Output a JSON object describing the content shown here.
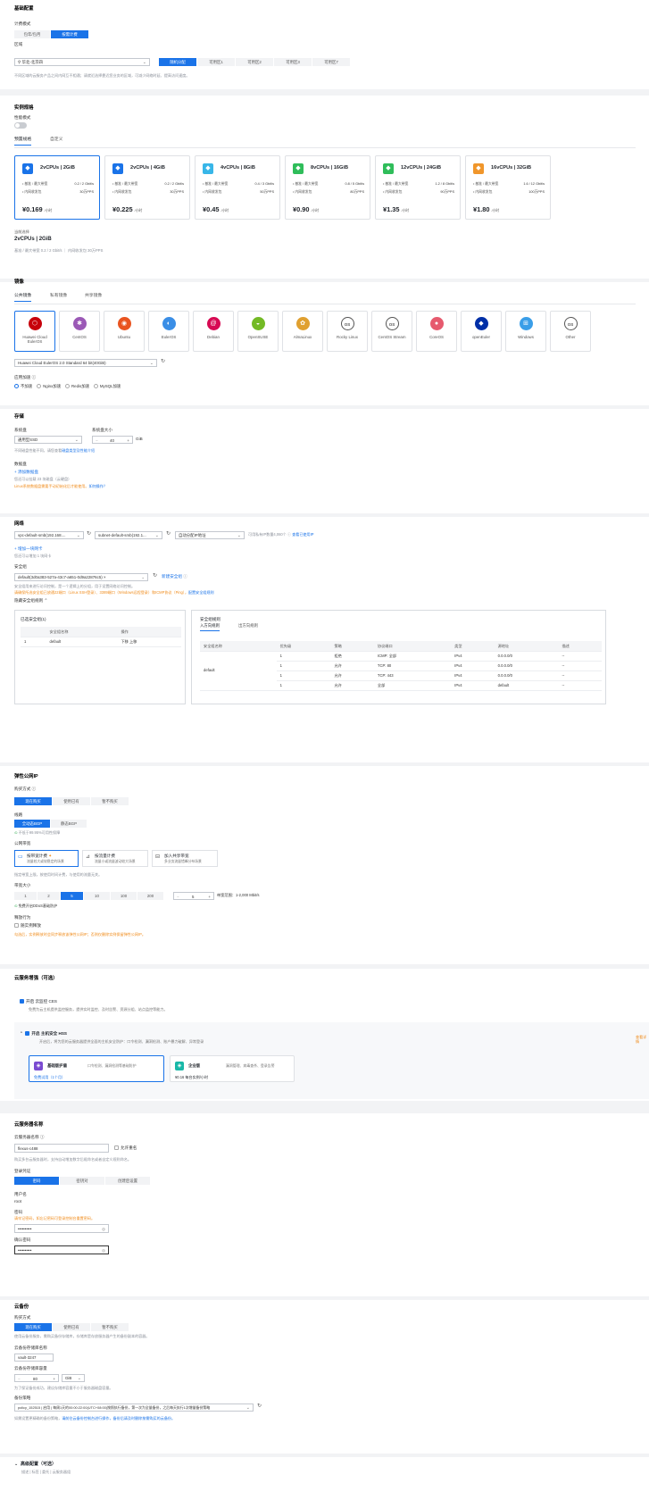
{
  "basic": {
    "title": "基础配置",
    "billing_label": "计费模式",
    "billing_options": [
      "包年/包月",
      "按需计费"
    ],
    "region_label": "区域",
    "region_value": "华北-北京四",
    "az_options": [
      "随机分配",
      "可用区1",
      "可用区2",
      "可用区3",
      "可用区7"
    ],
    "region_tip": "不同区域的云服务产品之间内网互不相通；请就近选择靠近您业务的区域，可减少网络时延、提高访问速度。"
  },
  "spec": {
    "title": "实例规格",
    "mode_label": "性能模式",
    "tabs": [
      "预置规格",
      "自定义"
    ],
    "bw_label": "基准 / 最大带宽",
    "pps_label": "内网收发包",
    "unit": "/小时",
    "cards": [
      {
        "name": "2vCPUs | 2GiB",
        "bw": "0.2 / 2 Gbit/s",
        "pps": "30万PPS",
        "price": "¥0.169",
        "icon": "◆",
        "color": "#1a73e8"
      },
      {
        "name": "2vCPUs | 4GiB",
        "bw": "0.2 / 2 Gbit/s",
        "pps": "30万PPS",
        "price": "¥0.225",
        "icon": "◆",
        "color": "#1a73e8"
      },
      {
        "name": "4vCPUs | 8GiB",
        "bw": "0.4 / 3 Gbit/s",
        "pps": "50万PPS",
        "price": "¥0.45",
        "icon": "◆",
        "color": "#38b6e8"
      },
      {
        "name": "8vCPUs | 16GiB",
        "bw": "0.8 / 5 Gbit/s",
        "pps": "80万PPS",
        "price": "¥0.90",
        "icon": "◆",
        "color": "#2fbd5a"
      },
      {
        "name": "12vCPUs | 24GiB",
        "bw": "1.2 / 8 Gbit/s",
        "pps": "90万PPS",
        "price": "¥1.35",
        "icon": "◆",
        "color": "#2fbd5a"
      },
      {
        "name": "16vCPUs | 32GiB",
        "bw": "1.6 / 12 Gbit/s",
        "pps": "100万PPS",
        "price": "¥1.80",
        "icon": "◆",
        "color": "#f0962b"
      }
    ],
    "current_label": "当前选择",
    "current_value": "2vCPUs | 2GiB",
    "current_detail": "基准 / 最大带宽 0.2 / 2 Gbit/s ｜ 内网收发包 30万PPS"
  },
  "image": {
    "title": "镜像",
    "tabs": [
      "公共镜像",
      "私有镜像",
      "共享镜像"
    ],
    "os": [
      {
        "name": "Huawei Cloud EulerOS",
        "color": "#c7000b",
        "glyph": "⬡"
      },
      {
        "name": "CentOS",
        "color": "#9b59b6",
        "glyph": "✱"
      },
      {
        "name": "Ubuntu",
        "color": "#e95420",
        "glyph": "◉"
      },
      {
        "name": "EulerOS",
        "color": "#3a8ee6",
        "glyph": "◐"
      },
      {
        "name": "Debian",
        "color": "#d70a53",
        "glyph": "@"
      },
      {
        "name": "OpenSUSE",
        "color": "#73ba25",
        "glyph": "◒"
      },
      {
        "name": "AlmaLinux",
        "color": "#e0a030",
        "glyph": "✿"
      },
      {
        "name": "Rocky Linux",
        "color": "#555555",
        "glyph": "OS"
      },
      {
        "name": "CentOS Stream",
        "color": "#555555",
        "glyph": "OS"
      },
      {
        "name": "CoreOS",
        "color": "#e65a6e",
        "glyph": "●"
      },
      {
        "name": "openEuler",
        "color": "#002fa7",
        "glyph": "◆"
      },
      {
        "name": "Windows",
        "color": "#3a9ee8",
        "glyph": "⊞"
      },
      {
        "name": "Other",
        "color": "#555555",
        "glyph": "OS"
      }
    ],
    "version": "Huawei Cloud EulerOS 2.0 Standard 64 bit(40GiB)",
    "accel_label": "应用加速",
    "accel_options": [
      "不加速",
      "Nginx加速",
      "Redis加速",
      "MySQL加速"
    ]
  },
  "storage": {
    "title": "存储",
    "sys_label": "系统盘",
    "sys_value": "通用型SSD",
    "size_label": "系统盘大小",
    "size_value": "40",
    "size_unit": "GiB",
    "tip1": "不同磁盘性能不同，请您查看",
    "tip1_link": "磁盘类型及性能介绍",
    "data_label": "数据盘",
    "add_link": "+ 添加数据盘",
    "tip2": "您还可以挂载 23 块磁盘（云硬盘）",
    "tip3": "Linux系统数据盘需要手动初始化后才能使用。",
    "tip3_link": "如何操作？"
  },
  "network": {
    "title": "网络",
    "vpc": "vpc-default-smb(192.168....",
    "subnet": "subnet-default-smb(192.1...",
    "ip": "自动分配IP地址",
    "ip_tip": "可用私有IP数量4,060个",
    "ip_link": "查看已使用IP",
    "add_nic": "+ 增加一块网卡",
    "nic_tip": "您还可以增加 1 块网卡",
    "sg_label": "安全组",
    "sg_value": "default(3d0a383-527a-43c7-a651-0d9a22876c5)",
    "sg_link": "新建安全组",
    "sg_tip1": "安全组用来进行访问控制，是一个逻辑上的分组，用于设置网络访问控制。",
    "sg_tip2": "请确保所选安全组已放通22端口（Linux SSH登录）、3389端口（Windows远程登录）和ICMP协议（Ping），",
    "sg_tip2_link": "配置安全组规则",
    "hide_rules": "隐藏安全组规则",
    "selected_title": "已选安全组(1)",
    "sel_cols": [
      "",
      "安全组名称",
      "操作"
    ],
    "sel_rows": [
      [
        "1",
        "default",
        "下移 上移"
      ]
    ],
    "rules_title": "安全组规则",
    "rule_tabs": [
      "入方向规则",
      "出方向规则"
    ],
    "rule_cols": [
      "安全组名称",
      "优先级",
      "策略",
      "协议端口",
      "类型",
      "源地址",
      "描述"
    ],
    "rule_group": "default",
    "rule_rows": [
      [
        "1",
        "拒绝",
        "ICMP: 全部",
        "IPv4",
        "0.0.0.0/0",
        "--"
      ],
      [
        "1",
        "允许",
        "TCP: 80",
        "IPv4",
        "0.0.0.0/0",
        "--"
      ],
      [
        "1",
        "允许",
        "TCP: 443",
        "IPv4",
        "0.0.0.0/0",
        "--"
      ],
      [
        "1",
        "允许",
        "全部",
        "IPv4",
        "default",
        "--"
      ]
    ]
  },
  "eip": {
    "title": "弹性公网IP",
    "buy_label": "购买方式",
    "buy_options": [
      "现在购买",
      "使用已有",
      "暂不购买"
    ],
    "line_label": "线路",
    "line_options": [
      "全动态BGP",
      "静态BGP"
    ],
    "sla": "不低于99.95%可用性保障",
    "type_label": "公网带宽",
    "bw_types": [
      {
        "name": "按带宽计费",
        "desc": "流量较大或较稳定的场景"
      },
      {
        "name": "按流量计费",
        "desc": "流量小或流量波动较大场景"
      },
      {
        "name": "加入共享带宽",
        "desc": "多业务流量错峰分布场景"
      }
    ],
    "bw_tip": "指定带宽上限，按使用时间计费，与使用的流量无关。",
    "size_label": "带宽大小",
    "sizes": [
      "1",
      "2",
      "5",
      "10",
      "100",
      "200"
    ],
    "size_input": "5",
    "size_range": "带宽范围：1-2,000 Mbit/s",
    "ddos": "免费开启DDoS基础防护",
    "release_label": "释放行为",
    "release_opt": "随实例释放",
    "release_tip": "勾选后，实例释放时会同步释放该弹性公网IP；否则仅删除实例保留弹性公网IP。"
  },
  "addon": {
    "title": "云服务增强（可选）",
    "ces_name": "开启 云监控 CES",
    "ces_desc": "免费为云主机提供监控服务，提供实时监控、及时告警、资源分组、站点监控等能力。",
    "hss_name": "开启 主机安全 HSS",
    "hss_desc": "开启后，将为您的云服务器提供全面的主机安全防护：口令检测、漏洞检测、账户暴力破解、异常登录",
    "hss_link": "查看详情",
    "p1_name": "基础版护盾",
    "p1_desc": "口令检测、漏洞检测等基础防护",
    "p1_price": "免费试用（1个月）",
    "p2_name": "企业版",
    "p2_desc": "漏洞管理、病毒查杀、登录告警",
    "p2_price": "¥0.16 每台实例/小时"
  },
  "server": {
    "title": "云服务器名称",
    "name_label": "云服务器名称",
    "name_value": "flexus-c488",
    "allow_dup": "允许重名",
    "name_tip": "购买多台云服务器时，支持自动增加数字后缀命名或者自定义规则命名。",
    "login_label": "登录凭证",
    "login_options": [
      "密码",
      "密钥对",
      "创建后设置"
    ],
    "user_label": "用户名",
    "user_value": "root",
    "pwd_label": "密码",
    "pwd_tip": "请牢记密码，如忘记密码可登录控制台重置密码。",
    "pwd_value": "••••••••••",
    "confirm_label": "确认密码",
    "confirm_value": "••••••••••"
  },
  "backup": {
    "title": "云备份",
    "buy_label": "购买方式",
    "buy_options": [
      "现在购买",
      "使用已有",
      "暂不购买"
    ],
    "tip": "使用云备份服务，需购买备份存储库，存储库是存放服务器产生的备份副本的容器。",
    "vault_label": "云备份存储库名称",
    "vault_value": "vault-3247",
    "cap_label": "云备份存储库容量",
    "cap_value": "80",
    "cap_unit": "GiB",
    "cap_tip": "为了保证备份成功，建议存储库容量不小于服务器磁盘容量。",
    "policy_label": "备份策略",
    "policy_value": "policy_152515 | 启用 | 每周1天的00:00:22:00(UTC+08:00)按照执行备份，第一次为全量备份，之后每天执行1次增量备份策略",
    "policy_tip": "如需设置更精确的备份策略，",
    "policy_link": "请前往云备份控制台进行操作，备份后请及时删除按需购买的云备份。"
  },
  "advanced": {
    "title": "高级配置（可选）",
    "desc": "描述 | 标签 | 委托 | 云服务器组"
  }
}
